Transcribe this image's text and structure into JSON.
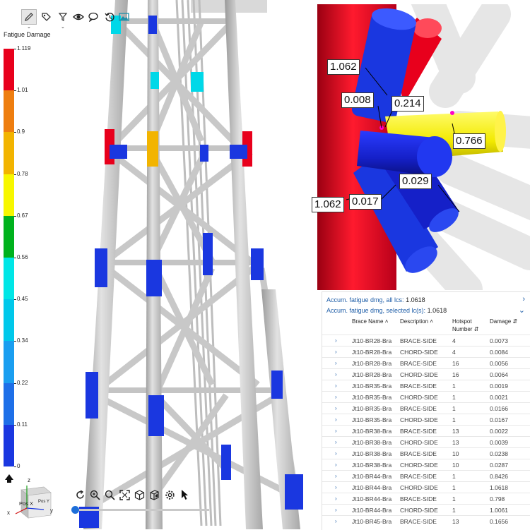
{
  "toolbar": {
    "icons": [
      "pen-icon",
      "tag-icon",
      "filter-icon",
      "eye-icon",
      "speech-bubble-icon",
      "history-icon",
      "image-icon"
    ]
  },
  "legend": {
    "title": "Fatigue Damage",
    "levels": [
      "1.119",
      "1.01",
      "0.9",
      "0.78",
      "0.67",
      "0.56",
      "0.45",
      "0.34",
      "0.22",
      "0.11",
      "0"
    ],
    "colors": [
      "#e8001c",
      "#ee7e10",
      "#f2b400",
      "#f7f700",
      "#00b21d",
      "#00e6e6",
      "#00c8ea",
      "#1a9ef0",
      "#1e6fe8",
      "#1a37e0"
    ]
  },
  "colors": {
    "red": "#e8001c",
    "blue": "#1520c8",
    "yellow": "#f5ee00",
    "cyan": "#00d8e8",
    "orange": "#f2b400",
    "steel": "#c8c8c8",
    "link": "#1f5ea8"
  },
  "axes": {
    "z": "z",
    "x": "x",
    "y": "y",
    "face_front": "Pos X",
    "face_side": "Pos Y"
  },
  "view_toolbar": {
    "icons": [
      "rotate-icon",
      "zoom-in-icon",
      "zoom-icon",
      "fit-all-icon",
      "cube-view-icon",
      "section-icon",
      "settings-icon",
      "pointer-icon"
    ]
  },
  "callouts": [
    "1.062",
    "0.008",
    "0.214",
    "0.766",
    "0.029",
    "1.062",
    "0.017"
  ],
  "panel": {
    "accum_all_label": "Accum. fatigue dmg, all lcs:",
    "accum_all_value": "1.0618",
    "accum_sel_label": "Accum. fatigue dmg, selected lc(s):",
    "accum_sel_value": "1.0618",
    "columns": [
      "Brace Name",
      "Description",
      "Hotspot Number",
      "Damage"
    ],
    "rows": [
      {
        "brace": "Jt10-BR28-Bra",
        "desc": "BRACE-SIDE",
        "hotspot": "4",
        "damage": "0.0073"
      },
      {
        "brace": "Jt10-BR28-Bra",
        "desc": "CHORD-SIDE",
        "hotspot": "4",
        "damage": "0.0084"
      },
      {
        "brace": "Jt10-BR28-Bra",
        "desc": "BRACE-SIDE",
        "hotspot": "16",
        "damage": "0.0056"
      },
      {
        "brace": "Jt10-BR28-Bra",
        "desc": "CHORD-SIDE",
        "hotspot": "16",
        "damage": "0.0064"
      },
      {
        "brace": "Jt10-BR35-Bra",
        "desc": "BRACE-SIDE",
        "hotspot": "1",
        "damage": "0.0019"
      },
      {
        "brace": "Jt10-BR35-Bra",
        "desc": "CHORD-SIDE",
        "hotspot": "1",
        "damage": "0.0021"
      },
      {
        "brace": "Jt10-BR35-Bra",
        "desc": "BRACE-SIDE",
        "hotspot": "1",
        "damage": "0.0166"
      },
      {
        "brace": "Jt10-BR35-Bra",
        "desc": "CHORD-SIDE",
        "hotspot": "1",
        "damage": "0.0167"
      },
      {
        "brace": "Jt10-BR38-Bra",
        "desc": "BRACE-SIDE",
        "hotspot": "13",
        "damage": "0.0022"
      },
      {
        "brace": "Jt10-BR38-Bra",
        "desc": "CHORD-SIDE",
        "hotspot": "13",
        "damage": "0.0039"
      },
      {
        "brace": "Jt10-BR38-Bra",
        "desc": "BRACE-SIDE",
        "hotspot": "10",
        "damage": "0.0238"
      },
      {
        "brace": "Jt10-BR38-Bra",
        "desc": "CHORD-SIDE",
        "hotspot": "10",
        "damage": "0.0287"
      },
      {
        "brace": "Jt10-BR44-Bra",
        "desc": "BRACE-SIDE",
        "hotspot": "1",
        "damage": "0.8426"
      },
      {
        "brace": "Jt10-BR44-Bra",
        "desc": "CHORD-SIDE",
        "hotspot": "1",
        "damage": "1.0618"
      },
      {
        "brace": "Jt10-BR44-Bra",
        "desc": "BRACE-SIDE",
        "hotspot": "1",
        "damage": "0.798"
      },
      {
        "brace": "Jt10-BR44-Bra",
        "desc": "CHORD-SIDE",
        "hotspot": "1",
        "damage": "1.0061"
      },
      {
        "brace": "Jt10-BR45-Bra",
        "desc": "BRACE-SIDE",
        "hotspot": "13",
        "damage": "0.1656"
      }
    ]
  }
}
